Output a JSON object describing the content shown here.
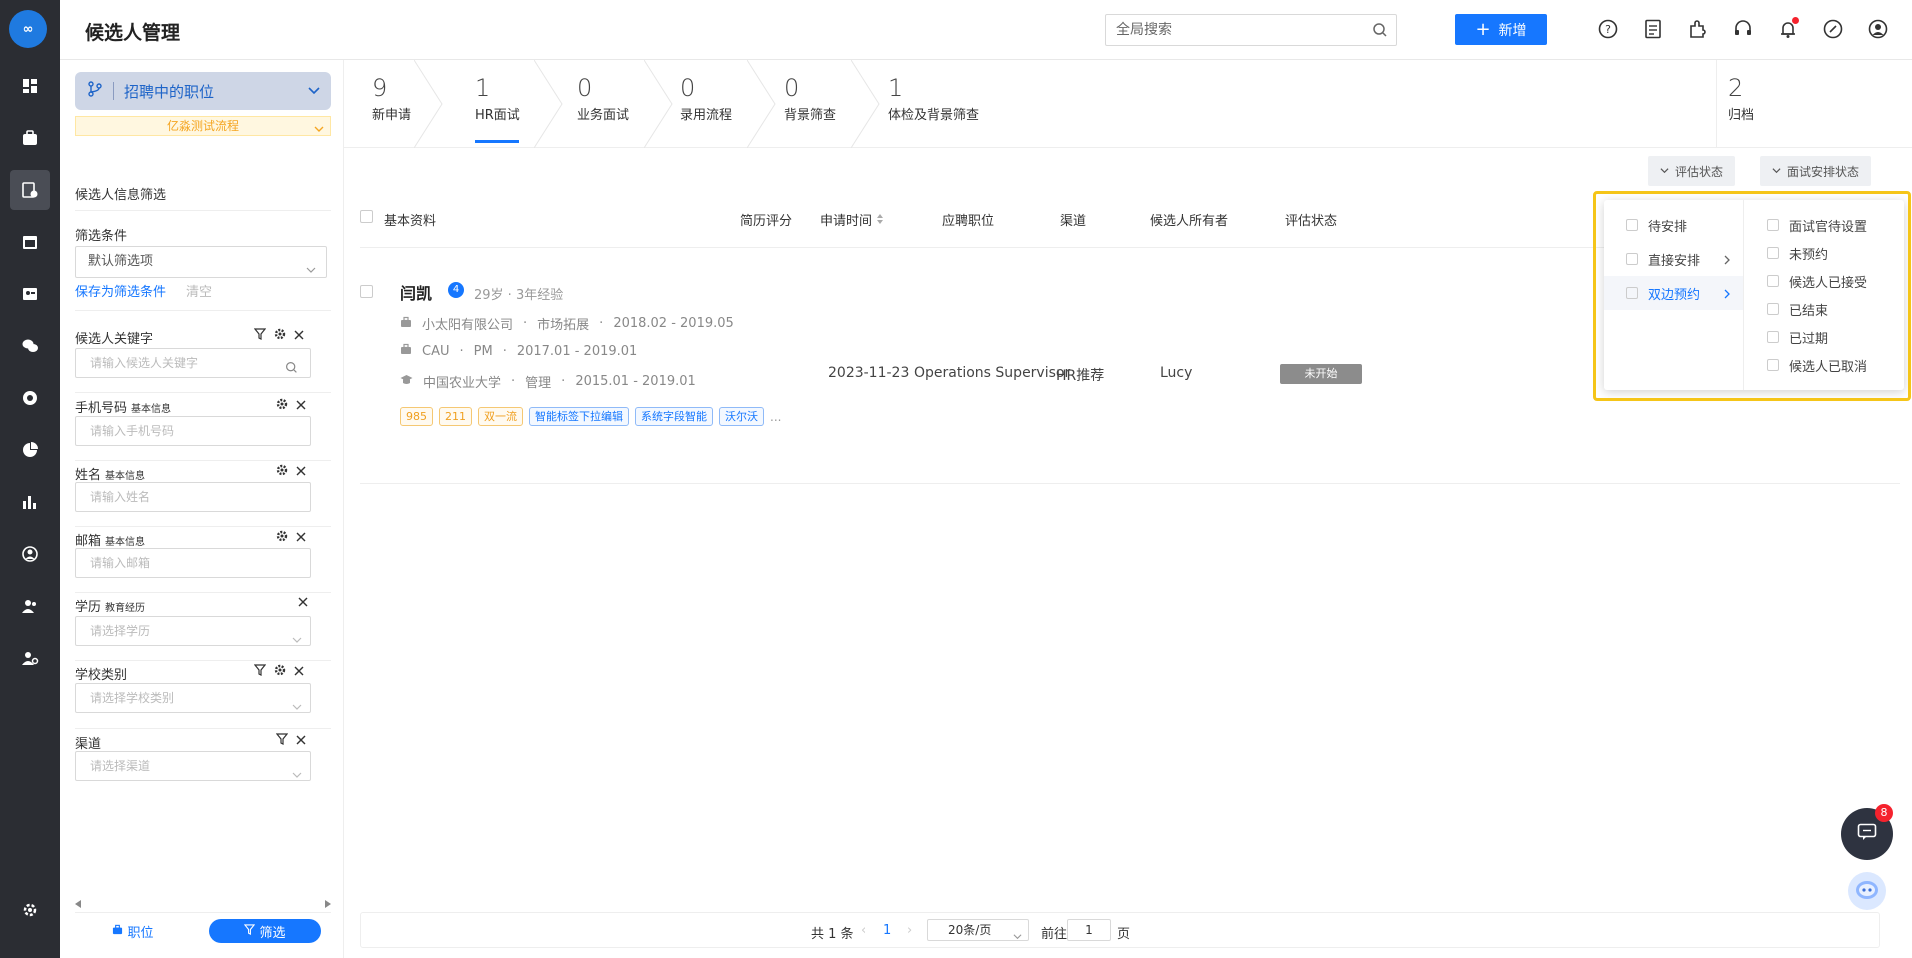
{
  "app": {
    "logo_text": "∞",
    "page_title": "候选人管理"
  },
  "header": {
    "search_placeholder": "全局搜索",
    "add_label": "新增"
  },
  "filter_panel": {
    "position_selector": "招聘中的职位",
    "flow_tag": "亿淼测试流程",
    "info_filter_title": "候选人信息筛选",
    "conditions_title": "筛选条件",
    "conditions_value": "默认筛选项",
    "save_link": "保存为筛选条件",
    "clear_link": "清空",
    "fields": [
      {
        "label": "候选人关键字",
        "sub": "",
        "placeholder": "请输入候选人关键字"
      },
      {
        "label": "手机号码",
        "sub": "基本信息",
        "placeholder": "请输入手机号码"
      },
      {
        "label": "姓名",
        "sub": "基本信息",
        "placeholder": "请输入姓名"
      },
      {
        "label": "邮箱",
        "sub": "基本信息",
        "placeholder": "请输入邮箱"
      },
      {
        "label": "学历",
        "sub": "教育经历",
        "placeholder": "请选择学历"
      },
      {
        "label": "学校类别",
        "sub": "",
        "placeholder": "请选择学校类别"
      },
      {
        "label": "渠道",
        "sub": "",
        "placeholder": "请选择渠道"
      }
    ],
    "bottom_tabs": {
      "positions": "职位",
      "filter": "筛选"
    }
  },
  "stages": [
    {
      "count": "9",
      "label": "新申请"
    },
    {
      "count": "1",
      "label": "HR面试"
    },
    {
      "count": "0",
      "label": "业务面试"
    },
    {
      "count": "0",
      "label": "录用流程"
    },
    {
      "count": "0",
      "label": "背景筛查"
    },
    {
      "count": "1",
      "label": "体检及背景筛查"
    },
    {
      "count": "2",
      "label": "归档"
    }
  ],
  "column_buttons": {
    "eval_status": "评估状态",
    "interview_status": "面试安排状态"
  },
  "table": {
    "headers": {
      "basic": "基本资料",
      "resume_score": "简历评分",
      "apply_time": "申请时间",
      "position": "应聘职位",
      "channel": "渠道",
      "owner": "候选人所有者",
      "eval_status": "评估状态"
    },
    "row": {
      "name": "闫凯",
      "badge": "4",
      "age": "29岁",
      "experience": "3年经验",
      "work": {
        "company": "小太阳有限公司",
        "dept": "市场拓展",
        "period": "2018.02 - 2019.05"
      },
      "project": {
        "org": "CAU",
        "role": "PM",
        "period": "2017.01 - 2019.01"
      },
      "education": {
        "school": "中国农业大学",
        "major": "管理",
        "period": "2015.01 - 2019.01"
      },
      "tags_yellow": [
        "985",
        "211",
        "双一流"
      ],
      "tags_blue": [
        "智能标签下拉编辑",
        "系统字段智能",
        "沃尔沃"
      ],
      "tags_more": "...",
      "apply_time": "2023-11-23",
      "position": "Operations Supervisor",
      "channel": "HR推荐",
      "owner": "Lucy",
      "eval_status": "未开始"
    }
  },
  "popup": {
    "col1": [
      "待安排",
      "直接安排",
      "双边预约"
    ],
    "col2": [
      "面试官待设置",
      "未预约",
      "候选人已接受",
      "已结束",
      "已过期",
      "候选人已取消"
    ]
  },
  "pager": {
    "total": "共 1 条",
    "current": "1",
    "page_size": "20条/页",
    "goto": "前往",
    "goto_value": "1",
    "page_unit": "页"
  },
  "chat": {
    "count": "8"
  }
}
